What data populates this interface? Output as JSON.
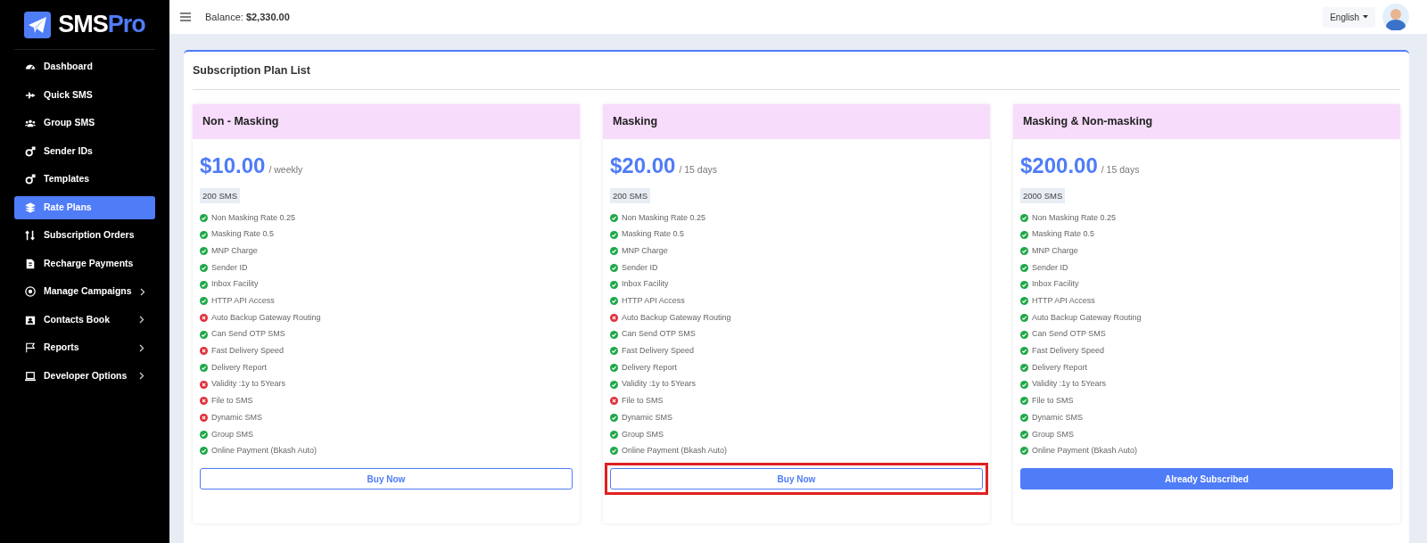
{
  "logo": {
    "text_main": "SMS",
    "text_accent": "Pro"
  },
  "sidebar": {
    "items": [
      {
        "label": "Dashboard",
        "selected": false,
        "has_submenu": false
      },
      {
        "label": "Quick SMS",
        "selected": false,
        "has_submenu": false
      },
      {
        "label": "Group SMS",
        "selected": false,
        "has_submenu": false
      },
      {
        "label": "Sender IDs",
        "selected": false,
        "has_submenu": false
      },
      {
        "label": "Templates",
        "selected": false,
        "has_submenu": false
      },
      {
        "label": "Rate Plans",
        "selected": true,
        "has_submenu": false
      },
      {
        "label": "Subscription Orders",
        "selected": false,
        "has_submenu": false
      },
      {
        "label": "Recharge Payments",
        "selected": false,
        "has_submenu": false
      },
      {
        "label": "Manage Campaigns",
        "selected": false,
        "has_submenu": true
      },
      {
        "label": "Contacts Book",
        "selected": false,
        "has_submenu": true
      },
      {
        "label": "Reports",
        "selected": false,
        "has_submenu": true
      },
      {
        "label": "Developer Options",
        "selected": false,
        "has_submenu": true
      }
    ]
  },
  "topbar": {
    "balance_label": "Balance:",
    "balance_value": "$2,330.00",
    "language": "English"
  },
  "panel": {
    "title": "Subscription Plan List"
  },
  "plans": [
    {
      "name": "Non - Masking",
      "price": "$10.00",
      "period": "/ weekly",
      "sms": "200 SMS",
      "highlighted": false,
      "subscribed": false,
      "button": "Buy Now",
      "features": [
        {
          "label": "Non Masking Rate 0.25",
          "included": true
        },
        {
          "label": "Masking Rate 0.5",
          "included": true
        },
        {
          "label": "MNP Charge",
          "included": true
        },
        {
          "label": "Sender ID",
          "included": true
        },
        {
          "label": "Inbox Facility",
          "included": true
        },
        {
          "label": "HTTP API Access",
          "included": true
        },
        {
          "label": "Auto Backup Gateway Routing",
          "included": false
        },
        {
          "label": "Can Send OTP SMS",
          "included": true
        },
        {
          "label": "Fast Delivery Speed",
          "included": false
        },
        {
          "label": "Delivery Report",
          "included": true
        },
        {
          "label": "Validity :1y to 5Years",
          "included": false
        },
        {
          "label": "File to SMS",
          "included": false
        },
        {
          "label": "Dynamic SMS",
          "included": false
        },
        {
          "label": "Group SMS",
          "included": true
        },
        {
          "label": "Online Payment (Bkash Auto)",
          "included": true
        }
      ]
    },
    {
      "name": "Masking",
      "price": "$20.00",
      "period": "/ 15 days",
      "sms": "200 SMS",
      "highlighted": true,
      "subscribed": false,
      "button": "Buy Now",
      "features": [
        {
          "label": "Non Masking Rate 0.25",
          "included": true
        },
        {
          "label": "Masking Rate 0.5",
          "included": true
        },
        {
          "label": "MNP Charge",
          "included": true
        },
        {
          "label": "Sender ID",
          "included": true
        },
        {
          "label": "Inbox Facility",
          "included": true
        },
        {
          "label": "HTTP API Access",
          "included": true
        },
        {
          "label": "Auto Backup Gateway Routing",
          "included": false
        },
        {
          "label": "Can Send OTP SMS",
          "included": true
        },
        {
          "label": "Fast Delivery Speed",
          "included": true
        },
        {
          "label": "Delivery Report",
          "included": true
        },
        {
          "label": "Validity :1y to 5Years",
          "included": true
        },
        {
          "label": "File to SMS",
          "included": false
        },
        {
          "label": "Dynamic SMS",
          "included": true
        },
        {
          "label": "Group SMS",
          "included": true
        },
        {
          "label": "Online Payment (Bkash Auto)",
          "included": true
        }
      ]
    },
    {
      "name": "Masking & Non-masking",
      "price": "$200.00",
      "period": "/ 15 days",
      "sms": "2000 SMS",
      "highlighted": false,
      "subscribed": true,
      "button": "Already Subscribed",
      "features": [
        {
          "label": "Non Masking Rate 0.25",
          "included": true
        },
        {
          "label": "Masking Rate 0.5",
          "included": true
        },
        {
          "label": "MNP Charge",
          "included": true
        },
        {
          "label": "Sender ID",
          "included": true
        },
        {
          "label": "Inbox Facility",
          "included": true
        },
        {
          "label": "HTTP API Access",
          "included": true
        },
        {
          "label": "Auto Backup Gateway Routing",
          "included": true
        },
        {
          "label": "Can Send OTP SMS",
          "included": true
        },
        {
          "label": "Fast Delivery Speed",
          "included": true
        },
        {
          "label": "Delivery Report",
          "included": true
        },
        {
          "label": "Validity :1y to 5Years",
          "included": true
        },
        {
          "label": "File to SMS",
          "included": true
        },
        {
          "label": "Dynamic SMS",
          "included": true
        },
        {
          "label": "Group SMS",
          "included": true
        },
        {
          "label": "Online Payment (Bkash Auto)",
          "included": true
        }
      ]
    }
  ]
}
